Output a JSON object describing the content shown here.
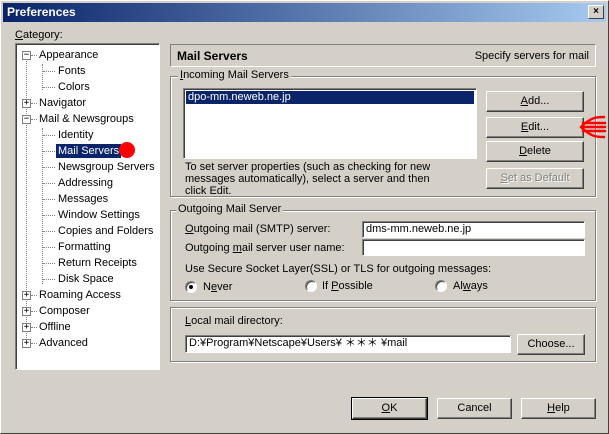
{
  "window": {
    "title": "Preferences",
    "close_glyph": "×"
  },
  "category": {
    "label_prefix": "",
    "label_accel": "C",
    "label_rest": "ategory:",
    "tree": [
      {
        "label": "Appearance",
        "expander": "−"
      },
      {
        "label": "Fonts"
      },
      {
        "label": "Colors"
      },
      {
        "label": "Navigator",
        "expander": "+"
      },
      {
        "label": "Mail & Newsgroups",
        "expander": "−"
      },
      {
        "label": "Identity"
      },
      {
        "label": "Mail Servers",
        "selected": true
      },
      {
        "label": "Newsgroup Servers"
      },
      {
        "label": "Addressing"
      },
      {
        "label": "Messages"
      },
      {
        "label": "Window Settings"
      },
      {
        "label": "Copies and Folders"
      },
      {
        "label": "Formatting"
      },
      {
        "label": "Return Receipts"
      },
      {
        "label": "Disk Space"
      },
      {
        "label": "Roaming Access",
        "expander": "+"
      },
      {
        "label": "Composer",
        "expander": "+"
      },
      {
        "label": "Offline",
        "expander": "+"
      },
      {
        "label": "Advanced",
        "expander": "+"
      }
    ]
  },
  "panel": {
    "title": "Mail Servers",
    "subtitle": "Specify servers for mail"
  },
  "incoming": {
    "legend_accel": "I",
    "legend_rest": "ncoming Mail Servers",
    "servers": [
      "dpo-mm.neweb.ne.jp"
    ],
    "add_accel": "A",
    "add_rest": "dd...",
    "edit_accel": "E",
    "edit_rest": "dit...",
    "delete_accel": "D",
    "delete_rest": "elete",
    "default_accel": "S",
    "default_rest": "et as Default",
    "note_line1": "To set server properties (such as checking for new",
    "note_line2": "messages automatically), select a server and then",
    "note_line3": "click Edit."
  },
  "outgoing": {
    "legend": "Outgoing Mail Server",
    "smtp_label_a": "",
    "smtp_label_accel": "O",
    "smtp_label_b": "utgoing mail (SMTP) server:",
    "smtp_value": "dms-mm.neweb.ne.jp",
    "user_label_a": "Outgoing ",
    "user_label_accel": "m",
    "user_label_b": "ail server user name:",
    "user_value": "",
    "ssl_label": "Use Secure Socket Layer(SSL) or TLS for outgoing messages:",
    "options": [
      {
        "accel": "e",
        "pre": "N",
        "post": "ver",
        "checked": true
      },
      {
        "accel": "P",
        "pre": "If ",
        "post": "ossible",
        "checked": false
      },
      {
        "accel": "w",
        "pre": "Al",
        "post": "ays",
        "checked": false
      }
    ]
  },
  "local": {
    "label_a": "",
    "label_accel": "L",
    "label_b": "ocal mail directory:",
    "path": "D:¥Program¥Netscape¥Users¥ ＊＊＊ ¥mail",
    "choose_label": "Choose..."
  },
  "footer": {
    "ok_accel": "O",
    "ok_rest": "K",
    "cancel_label": "Cancel",
    "help_accel": "H",
    "help_rest": "elp"
  },
  "colors": {
    "selection": "#0a246a",
    "annotation_dot": "#ff0000",
    "annotation_arrow": "#ff0000"
  }
}
